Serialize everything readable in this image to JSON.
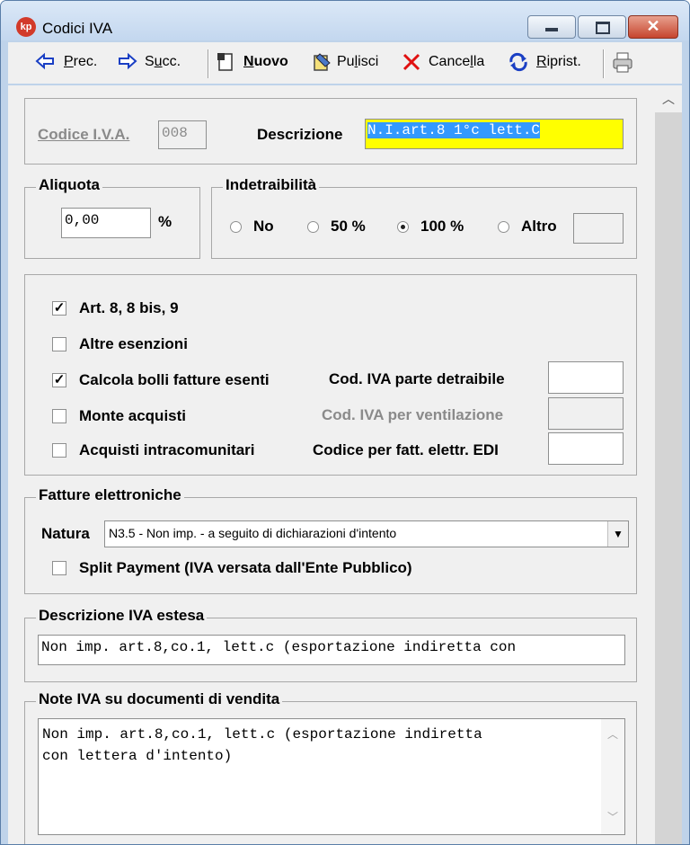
{
  "window": {
    "title": "Codici IVA",
    "app_icon_text": "kp",
    "close_glyph": "✕"
  },
  "toolbar": {
    "prev": {
      "pre": "",
      "ul": "P",
      "post": "rec."
    },
    "next": {
      "pre": "S",
      "ul": "u",
      "post": "cc."
    },
    "new": {
      "pre": "",
      "ul": "N",
      "post": "uovo"
    },
    "clean": {
      "pre": "Pu",
      "ul": "l",
      "post": "isci"
    },
    "delete": {
      "pre": "Cance",
      "ul": "l",
      "post": "la"
    },
    "restore": {
      "pre": "",
      "ul": "R",
      "post": "iprist."
    }
  },
  "header": {
    "code_label": "Codice I.V.A.",
    "code_value": "008",
    "desc_label": "Descrizione",
    "desc_value": "N.I.art.8 1°c lett.C"
  },
  "aliquota": {
    "legend": "Aliquota",
    "value": "0,00",
    "unit": "%"
  },
  "indetraibilita": {
    "legend": "Indetraibilità",
    "options": [
      {
        "label": "No",
        "selected": false
      },
      {
        "label": "50 %",
        "selected": false
      },
      {
        "label": "100 %",
        "selected": true
      },
      {
        "label": "Altro",
        "selected": false
      }
    ],
    "other_value": ""
  },
  "flags": {
    "art8": {
      "label": "Art. 8, 8 bis, 9",
      "checked": true
    },
    "altre": {
      "label": "Altre esenzioni",
      "checked": false
    },
    "bolli": {
      "label": "Calcola bolli fatture esenti",
      "checked": true
    },
    "monte": {
      "label": "Monte acquisti",
      "checked": false
    },
    "intra": {
      "label": "Acquisti intracomunitari",
      "checked": false
    },
    "cod_detraibile_label": "Cod. IVA parte detraibile",
    "cod_detraibile_value": "",
    "cod_ventilazione_label": "Cod. IVA per ventilazione",
    "cod_ventilazione_value": "",
    "cod_edi_label": "Codice per fatt. elettr. EDI",
    "cod_edi_value": "",
    "check_glyph": "✓"
  },
  "fatture": {
    "legend": "Fatture elettroniche",
    "natura_label": "Natura",
    "natura_value": "N3.5 - Non imp. - a seguito di dichiarazioni d'intento",
    "split_label": "Split Payment (IVA versata dall'Ente Pubblico)",
    "split_checked": false
  },
  "descrizione_estesa": {
    "legend": "Descrizione IVA estesa",
    "value": "Non imp. art.8,co.1, lett.c (esportazione indiretta con"
  },
  "note": {
    "legend": "Note IVA su documenti di vendita",
    "line1": "Non imp. art.8,co.1, lett.c (esportazione indiretta",
    "line2": "con lettera d'intento)"
  }
}
